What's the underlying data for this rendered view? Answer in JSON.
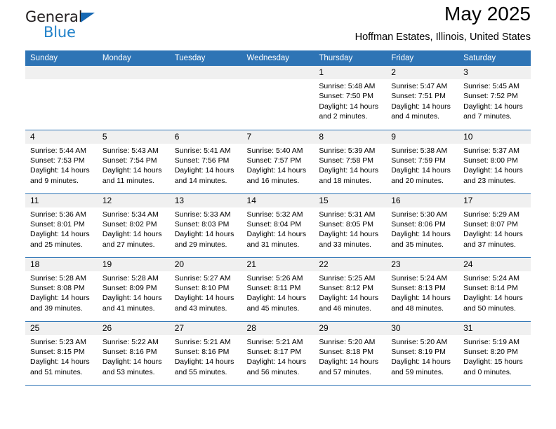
{
  "brand": {
    "line1": "General",
    "line2": "Blue",
    "triangle_color": "#1668b3",
    "blue_text_color": "#2081c9"
  },
  "header": {
    "title": "May 2025",
    "subtitle": "Hoffman Estates, Illinois, United States",
    "accent_color": "#2e74b5",
    "daynum_band_color": "#f0f0f0"
  },
  "weekdays": [
    "Sunday",
    "Monday",
    "Tuesday",
    "Wednesday",
    "Thursday",
    "Friday",
    "Saturday"
  ],
  "labels": {
    "sunrise_prefix": "Sunrise:",
    "sunset_prefix": "Sunset:",
    "daylight_prefix": "Daylight:"
  },
  "weeks": [
    [
      {
        "empty": true
      },
      {
        "empty": true
      },
      {
        "empty": true
      },
      {
        "empty": true
      },
      {
        "day": "1",
        "sunrise": "Sunrise: 5:48 AM",
        "sunset": "Sunset: 7:50 PM",
        "daylight1": "Daylight: 14 hours",
        "daylight2": "and 2 minutes."
      },
      {
        "day": "2",
        "sunrise": "Sunrise: 5:47 AM",
        "sunset": "Sunset: 7:51 PM",
        "daylight1": "Daylight: 14 hours",
        "daylight2": "and 4 minutes."
      },
      {
        "day": "3",
        "sunrise": "Sunrise: 5:45 AM",
        "sunset": "Sunset: 7:52 PM",
        "daylight1": "Daylight: 14 hours",
        "daylight2": "and 7 minutes."
      }
    ],
    [
      {
        "day": "4",
        "sunrise": "Sunrise: 5:44 AM",
        "sunset": "Sunset: 7:53 PM",
        "daylight1": "Daylight: 14 hours",
        "daylight2": "and 9 minutes."
      },
      {
        "day": "5",
        "sunrise": "Sunrise: 5:43 AM",
        "sunset": "Sunset: 7:54 PM",
        "daylight1": "Daylight: 14 hours",
        "daylight2": "and 11 minutes."
      },
      {
        "day": "6",
        "sunrise": "Sunrise: 5:41 AM",
        "sunset": "Sunset: 7:56 PM",
        "daylight1": "Daylight: 14 hours",
        "daylight2": "and 14 minutes."
      },
      {
        "day": "7",
        "sunrise": "Sunrise: 5:40 AM",
        "sunset": "Sunset: 7:57 PM",
        "daylight1": "Daylight: 14 hours",
        "daylight2": "and 16 minutes."
      },
      {
        "day": "8",
        "sunrise": "Sunrise: 5:39 AM",
        "sunset": "Sunset: 7:58 PM",
        "daylight1": "Daylight: 14 hours",
        "daylight2": "and 18 minutes."
      },
      {
        "day": "9",
        "sunrise": "Sunrise: 5:38 AM",
        "sunset": "Sunset: 7:59 PM",
        "daylight1": "Daylight: 14 hours",
        "daylight2": "and 20 minutes."
      },
      {
        "day": "10",
        "sunrise": "Sunrise: 5:37 AM",
        "sunset": "Sunset: 8:00 PM",
        "daylight1": "Daylight: 14 hours",
        "daylight2": "and 23 minutes."
      }
    ],
    [
      {
        "day": "11",
        "sunrise": "Sunrise: 5:36 AM",
        "sunset": "Sunset: 8:01 PM",
        "daylight1": "Daylight: 14 hours",
        "daylight2": "and 25 minutes."
      },
      {
        "day": "12",
        "sunrise": "Sunrise: 5:34 AM",
        "sunset": "Sunset: 8:02 PM",
        "daylight1": "Daylight: 14 hours",
        "daylight2": "and 27 minutes."
      },
      {
        "day": "13",
        "sunrise": "Sunrise: 5:33 AM",
        "sunset": "Sunset: 8:03 PM",
        "daylight1": "Daylight: 14 hours",
        "daylight2": "and 29 minutes."
      },
      {
        "day": "14",
        "sunrise": "Sunrise: 5:32 AM",
        "sunset": "Sunset: 8:04 PM",
        "daylight1": "Daylight: 14 hours",
        "daylight2": "and 31 minutes."
      },
      {
        "day": "15",
        "sunrise": "Sunrise: 5:31 AM",
        "sunset": "Sunset: 8:05 PM",
        "daylight1": "Daylight: 14 hours",
        "daylight2": "and 33 minutes."
      },
      {
        "day": "16",
        "sunrise": "Sunrise: 5:30 AM",
        "sunset": "Sunset: 8:06 PM",
        "daylight1": "Daylight: 14 hours",
        "daylight2": "and 35 minutes."
      },
      {
        "day": "17",
        "sunrise": "Sunrise: 5:29 AM",
        "sunset": "Sunset: 8:07 PM",
        "daylight1": "Daylight: 14 hours",
        "daylight2": "and 37 minutes."
      }
    ],
    [
      {
        "day": "18",
        "sunrise": "Sunrise: 5:28 AM",
        "sunset": "Sunset: 8:08 PM",
        "daylight1": "Daylight: 14 hours",
        "daylight2": "and 39 minutes."
      },
      {
        "day": "19",
        "sunrise": "Sunrise: 5:28 AM",
        "sunset": "Sunset: 8:09 PM",
        "daylight1": "Daylight: 14 hours",
        "daylight2": "and 41 minutes."
      },
      {
        "day": "20",
        "sunrise": "Sunrise: 5:27 AM",
        "sunset": "Sunset: 8:10 PM",
        "daylight1": "Daylight: 14 hours",
        "daylight2": "and 43 minutes."
      },
      {
        "day": "21",
        "sunrise": "Sunrise: 5:26 AM",
        "sunset": "Sunset: 8:11 PM",
        "daylight1": "Daylight: 14 hours",
        "daylight2": "and 45 minutes."
      },
      {
        "day": "22",
        "sunrise": "Sunrise: 5:25 AM",
        "sunset": "Sunset: 8:12 PM",
        "daylight1": "Daylight: 14 hours",
        "daylight2": "and 46 minutes."
      },
      {
        "day": "23",
        "sunrise": "Sunrise: 5:24 AM",
        "sunset": "Sunset: 8:13 PM",
        "daylight1": "Daylight: 14 hours",
        "daylight2": "and 48 minutes."
      },
      {
        "day": "24",
        "sunrise": "Sunrise: 5:24 AM",
        "sunset": "Sunset: 8:14 PM",
        "daylight1": "Daylight: 14 hours",
        "daylight2": "and 50 minutes."
      }
    ],
    [
      {
        "day": "25",
        "sunrise": "Sunrise: 5:23 AM",
        "sunset": "Sunset: 8:15 PM",
        "daylight1": "Daylight: 14 hours",
        "daylight2": "and 51 minutes."
      },
      {
        "day": "26",
        "sunrise": "Sunrise: 5:22 AM",
        "sunset": "Sunset: 8:16 PM",
        "daylight1": "Daylight: 14 hours",
        "daylight2": "and 53 minutes."
      },
      {
        "day": "27",
        "sunrise": "Sunrise: 5:21 AM",
        "sunset": "Sunset: 8:16 PM",
        "daylight1": "Daylight: 14 hours",
        "daylight2": "and 55 minutes."
      },
      {
        "day": "28",
        "sunrise": "Sunrise: 5:21 AM",
        "sunset": "Sunset: 8:17 PM",
        "daylight1": "Daylight: 14 hours",
        "daylight2": "and 56 minutes."
      },
      {
        "day": "29",
        "sunrise": "Sunrise: 5:20 AM",
        "sunset": "Sunset: 8:18 PM",
        "daylight1": "Daylight: 14 hours",
        "daylight2": "and 57 minutes."
      },
      {
        "day": "30",
        "sunrise": "Sunrise: 5:20 AM",
        "sunset": "Sunset: 8:19 PM",
        "daylight1": "Daylight: 14 hours",
        "daylight2": "and 59 minutes."
      },
      {
        "day": "31",
        "sunrise": "Sunrise: 5:19 AM",
        "sunset": "Sunset: 8:20 PM",
        "daylight1": "Daylight: 15 hours",
        "daylight2": "and 0 minutes."
      }
    ]
  ]
}
